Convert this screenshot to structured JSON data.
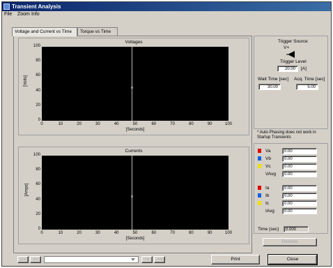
{
  "window": {
    "title": "Transient Analysis"
  },
  "menu": {
    "file": "File",
    "zoom": "Zoom",
    "info": "Info"
  },
  "tabs": [
    {
      "label": "Voltage and Current vs Time",
      "active": true
    },
    {
      "label": "Torque vs Time",
      "active": false
    }
  ],
  "voltage_chart": {
    "title": "Voltages",
    "ylabel": "[Volts]",
    "xlabel": "[Seconds]",
    "yticks": [
      "100",
      "80",
      "60",
      "40",
      "20",
      "0"
    ],
    "xticks": [
      "0",
      "10",
      "20",
      "30",
      "40",
      "50",
      "60",
      "70",
      "80",
      "90",
      "100"
    ]
  },
  "current_chart": {
    "title": "Currents",
    "ylabel": "[Amps]",
    "xlabel": "[Seconds]",
    "yticks": [
      "100",
      "80",
      "60",
      "40",
      "20",
      "0"
    ],
    "xticks": [
      "0",
      "10",
      "20",
      "30",
      "40",
      "50",
      "60",
      "70",
      "80",
      "90",
      "100"
    ]
  },
  "chart_data": [
    {
      "type": "line",
      "title": "Voltages",
      "xlabel": "[Seconds]",
      "ylabel": "[Volts]",
      "xlim": [
        0,
        100
      ],
      "ylim": [
        0,
        100
      ],
      "series": [],
      "cursor_x": 48,
      "cursor_y": 45
    },
    {
      "type": "line",
      "title": "Currents",
      "xlabel": "[Seconds]",
      "ylabel": "[Amps]",
      "xlim": [
        0,
        100
      ],
      "ylim": [
        0,
        100
      ],
      "series": [],
      "cursor_x": 48,
      "cursor_y": 45
    }
  ],
  "trigger": {
    "source_label": "Trigger Source",
    "source_value": "V+",
    "level_label": "Trigger Level",
    "level_value": "20.00",
    "level_unit": "[A]",
    "wait_label": "Wait Time [sec]",
    "wait_value": "30.00",
    "acq_label": "Acq. Time [sec]",
    "acq_value": "5.00"
  },
  "note": "* Auto Phasing does not work in Startup Transients",
  "voltages": [
    {
      "label": "Va",
      "value": "0.00",
      "color": "#e00000"
    },
    {
      "label": "Vb",
      "value": "0.00",
      "color": "#1060e0"
    },
    {
      "label": "Vc",
      "value": "0.00",
      "color": "#f0e000"
    },
    {
      "label": "VAvg",
      "value": "0.00",
      "color": ""
    }
  ],
  "currents": [
    {
      "label": "Ia",
      "value": "0.00",
      "color": "#e00000"
    },
    {
      "label": "Ib",
      "value": "0.00",
      "color": "#1060e0"
    },
    {
      "label": "Ic",
      "value": "0.00",
      "color": "#f0e000"
    },
    {
      "label": "IAvg",
      "value": "0.00",
      "color": ""
    }
  ],
  "time": {
    "label": "Time (sec)",
    "value": "0.000"
  },
  "buttons": {
    "restore": "Restore",
    "print": "Print",
    "close": "Close"
  },
  "nav": {
    "first": "|<<",
    "prev": "<<",
    "next": ">>",
    "last": ">>|"
  }
}
